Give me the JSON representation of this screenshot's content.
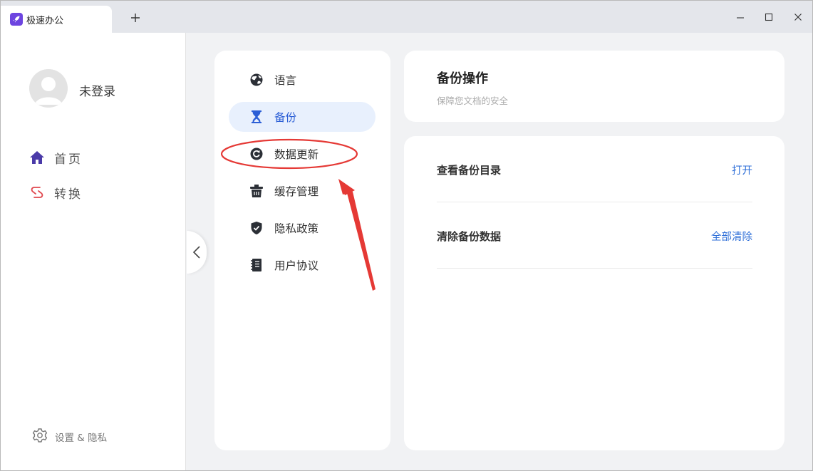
{
  "titlebar": {
    "tab_title": "极速办公"
  },
  "sidebar": {
    "user_name": "未登录",
    "nav": [
      {
        "label": "首页",
        "icon": "home-icon"
      },
      {
        "label": "转换",
        "icon": "convert-icon"
      }
    ],
    "settings_label": "设置 & 隐私"
  },
  "settings_menu": {
    "items": [
      {
        "label": "语言",
        "icon": "globe-icon",
        "active": false
      },
      {
        "label": "备份",
        "icon": "hourglass-icon",
        "active": true
      },
      {
        "label": "数据更新",
        "icon": "refresh-icon",
        "active": false
      },
      {
        "label": "缓存管理",
        "icon": "trash-icon",
        "active": false
      },
      {
        "label": "隐私政策",
        "icon": "shield-icon",
        "active": false
      },
      {
        "label": "用户协议",
        "icon": "notebook-icon",
        "active": false
      }
    ]
  },
  "panel": {
    "title": "备份操作",
    "subtitle": "保障您文档的安全",
    "rows": [
      {
        "label": "查看备份目录",
        "action": "打开"
      },
      {
        "label": "清除备份数据",
        "action": "全部清除"
      }
    ]
  },
  "colors": {
    "accent": "#2c5fd6",
    "active_bg": "#e8f0fd",
    "brand": "#6d45e0",
    "annotation": "#e53935"
  }
}
